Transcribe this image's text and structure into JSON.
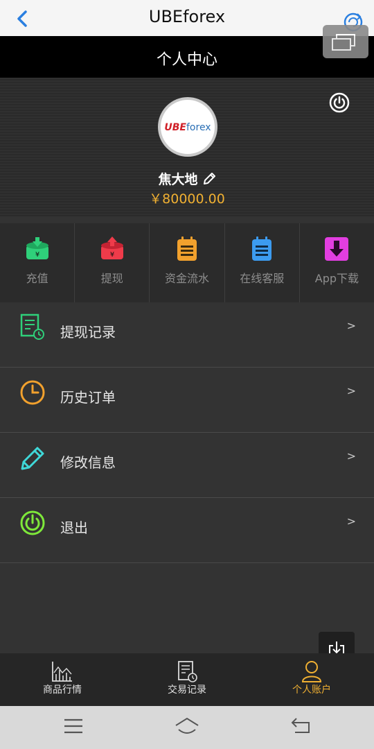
{
  "browser": {
    "title": "UBEforex"
  },
  "header": {
    "title": "个人中心"
  },
  "profile": {
    "logo_ube": "UBE",
    "logo_forex": "forex",
    "username": "焦大地",
    "balance": "￥80000.00"
  },
  "actions": [
    {
      "label": "充值",
      "icon": "deposit-icon",
      "color": "#2fd07a"
    },
    {
      "label": "提现",
      "icon": "withdraw-icon",
      "color": "#ef3b4a"
    },
    {
      "label": "资金流水",
      "icon": "ledger-icon",
      "color": "#f2a12d"
    },
    {
      "label": "在线客服",
      "icon": "support-icon",
      "color": "#3c9bf0"
    },
    {
      "label": "App下载",
      "icon": "app-download-icon",
      "color": "#e23ee0"
    }
  ],
  "menu": [
    {
      "label": "提现记录",
      "icon": "withdraw-record-icon",
      "arrow": ">"
    },
    {
      "label": "历史订单",
      "icon": "clock-icon",
      "arrow": ">"
    },
    {
      "label": "修改信息",
      "icon": "pencil-icon",
      "arrow": ">"
    },
    {
      "label": "退出",
      "icon": "power-icon",
      "arrow": ">"
    }
  ],
  "tabs": [
    {
      "label": "商品行情",
      "icon": "chart-icon"
    },
    {
      "label": "交易记录",
      "icon": "record-icon"
    },
    {
      "label": "个人账户",
      "icon": "user-icon",
      "active": true
    }
  ],
  "colors": {
    "accent": "#f0b032",
    "background": "#333333"
  }
}
